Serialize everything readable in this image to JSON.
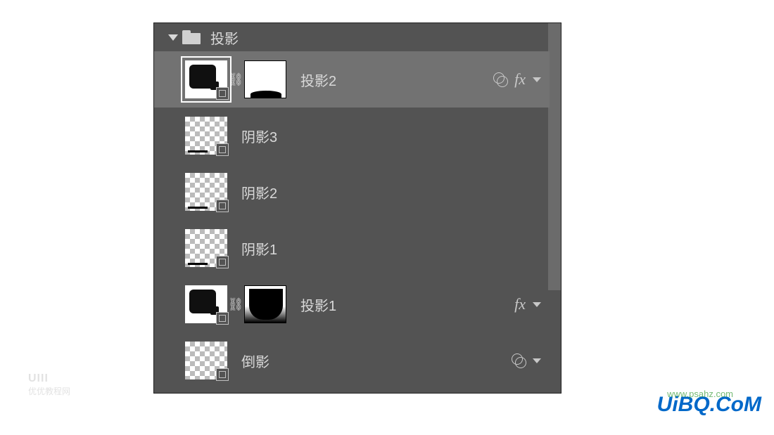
{
  "group": {
    "name": "投影"
  },
  "layers": [
    {
      "name": "投影2",
      "has_mask": true,
      "has_blend": true,
      "has_fx": true,
      "selected": true,
      "thumb": "dark"
    },
    {
      "name": "阴影3",
      "has_mask": false,
      "has_blend": false,
      "has_fx": false,
      "selected": false,
      "thumb": "checker"
    },
    {
      "name": "阴影2",
      "has_mask": false,
      "has_blend": false,
      "has_fx": false,
      "selected": false,
      "thumb": "checker"
    },
    {
      "name": "阴影1",
      "has_mask": false,
      "has_blend": false,
      "has_fx": false,
      "selected": false,
      "thumb": "checker"
    },
    {
      "name": "投影1",
      "has_mask": true,
      "mask_style": "bowl",
      "has_blend": false,
      "has_fx": true,
      "selected": false,
      "thumb": "dark"
    },
    {
      "name": "倒影",
      "has_mask": false,
      "has_blend": true,
      "has_fx": false,
      "selected": false,
      "thumb": "checker"
    }
  ],
  "icons": {
    "link": "⛓",
    "fx": "fx"
  },
  "watermarks": {
    "left_logo": "UIII",
    "left_text": "优优教程网",
    "right": "UiBQ.CoM",
    "right_small": "www.psahz.com"
  }
}
